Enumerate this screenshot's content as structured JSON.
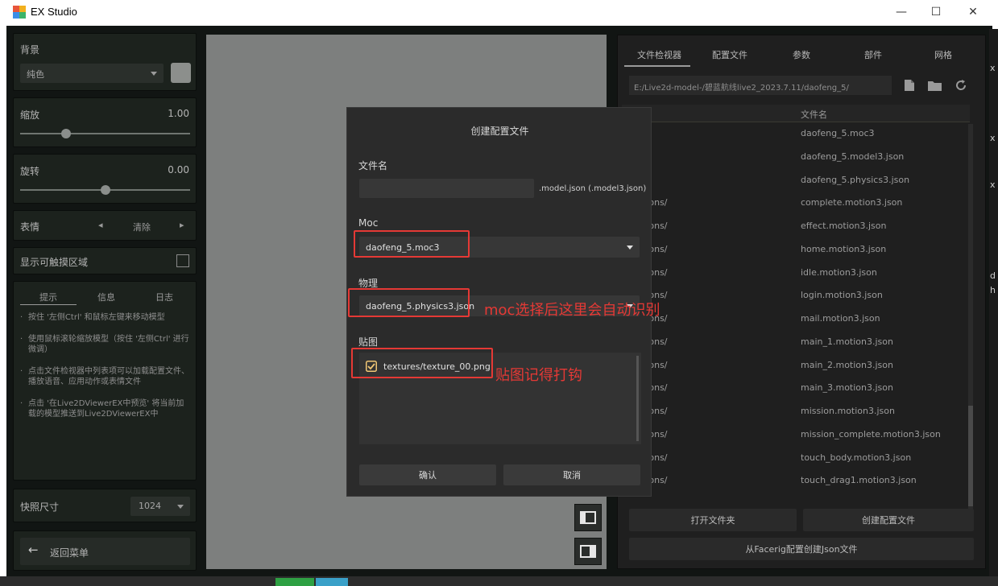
{
  "window": {
    "title": "EX Studio",
    "minimize_glyph": "—",
    "maximize_glyph": "☐",
    "close_glyph": "✕"
  },
  "left": {
    "background": {
      "label": "背景",
      "value": "纯色"
    },
    "scale": {
      "label": "缩放",
      "value": "1.00",
      "level": 0.27
    },
    "rotation": {
      "label": "旋转",
      "value": "0.00",
      "level": 0.5
    },
    "expression": {
      "label": "表情",
      "prev": "◂",
      "clear": "清除",
      "next": "▸"
    },
    "touch_area": {
      "label": "显示可触摸区域",
      "checked": false
    },
    "info_tabs": [
      "提示",
      "信息",
      "日志"
    ],
    "tips": [
      "按住 '左侧Ctrl' 和鼠标左键来移动模型",
      "使用鼠标滚轮缩放模型（按住 '左侧Ctrl' 进行微调）",
      "点击文件检视器中列表项可以加载配置文件、播放语音、应用动作或表情文件",
      "点击 '在Live2DViewerEX中预览' 将当前加载的模型推送到Live2DViewerEX中"
    ],
    "snapshot": {
      "label": "快照尺寸",
      "value": "1024"
    },
    "back": {
      "label": "返回菜单"
    }
  },
  "dialog": {
    "title": "创建配置文件",
    "filename_label": "文件名",
    "filename_value": "",
    "filename_suffix": ".model.json (.model3.json)",
    "moc_label": "Moc",
    "moc_value": "daofeng_5.moc3",
    "physics_label": "物理",
    "physics_value": "daofeng_5.physics3.json",
    "physics_note": "moc选择后这里会自动识别",
    "texture_label": "贴图",
    "texture_item": "textures/texture_00.png",
    "texture_checked": true,
    "texture_note": "贴图记得打钩",
    "confirm": "确认",
    "cancel": "取消"
  },
  "right": {
    "tabs": [
      "文件检视器",
      "配置文件",
      "参数",
      "部件",
      "网格"
    ],
    "path": "E:/Live2d-model-/碧蓝航线live2_2023.7.11/daofeng_5/",
    "column_header": "文件名",
    "files": [
      {
        "folder": "",
        "name": "daofeng_5.moc3"
      },
      {
        "folder": "",
        "name": "daofeng_5.model3.json"
      },
      {
        "folder": "",
        "name": "daofeng_5.physics3.json"
      },
      {
        "folder": "tions/",
        "name": "complete.motion3.json"
      },
      {
        "folder": "tions/",
        "name": "effect.motion3.json"
      },
      {
        "folder": "tions/",
        "name": "home.motion3.json"
      },
      {
        "folder": "tions/",
        "name": "idle.motion3.json"
      },
      {
        "folder": "tions/",
        "name": "login.motion3.json"
      },
      {
        "folder": "tions/",
        "name": "mail.motion3.json"
      },
      {
        "folder": "tions/",
        "name": "main_1.motion3.json"
      },
      {
        "folder": "tions/",
        "name": "main_2.motion3.json"
      },
      {
        "folder": "tions/",
        "name": "main_3.motion3.json"
      },
      {
        "folder": "tions/",
        "name": "mission.motion3.json"
      },
      {
        "folder": "tions/",
        "name": "mission_complete.motion3.json"
      },
      {
        "folder": "tions/",
        "name": "touch_body.motion3.json"
      },
      {
        "folder": "tions/",
        "name": "touch_drag1.motion3.json"
      }
    ],
    "open_folder": "打开文件夹",
    "create_config": "创建配置文件",
    "from_facerig": "从Facerig配置创建Json文件"
  },
  "colors": {
    "accent_red": "#e53935",
    "panel_bg": "#1c221d",
    "dialog_bg": "#2b2b2b"
  }
}
